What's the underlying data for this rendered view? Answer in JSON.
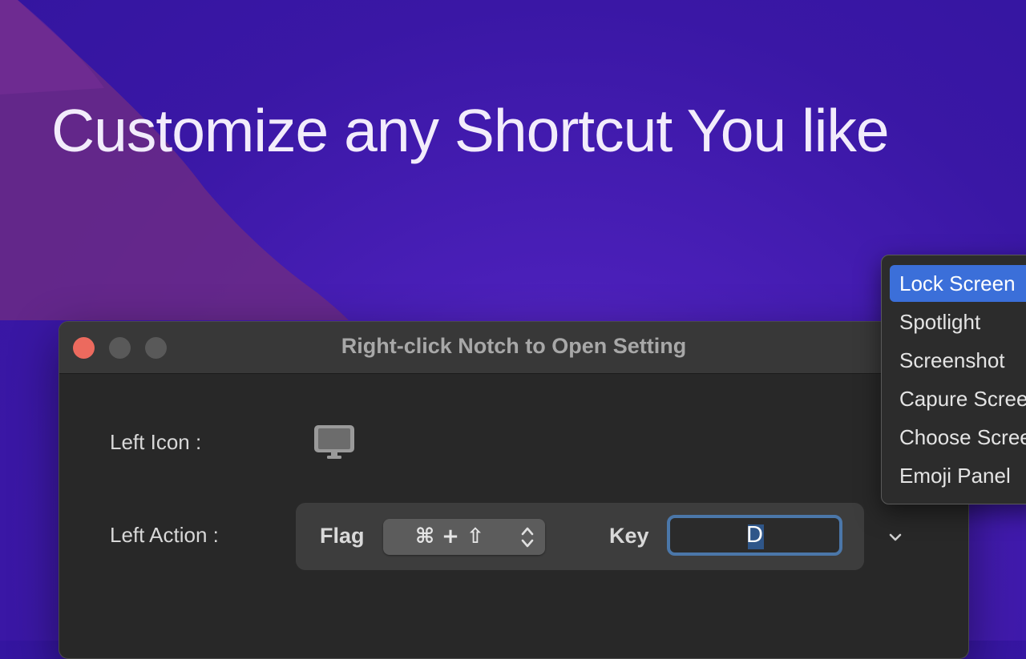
{
  "headline": "Customize any Shortcut You like",
  "window": {
    "title": "Right-click Notch to Open Setting",
    "controls": [
      "close",
      "minimize",
      "zoom"
    ]
  },
  "settings": {
    "left_icon_label": "Left Icon :",
    "left_icon": "monitor-icon",
    "left_action_label": "Left Action :",
    "flag_label": "Flag",
    "flag_value": "⌘ + ⇧",
    "key_label": "Key",
    "key_value": "D"
  },
  "menu": {
    "items": [
      {
        "label": "Lock Screen",
        "selected": true
      },
      {
        "label": "Spotlight",
        "selected": false
      },
      {
        "label": "Screenshot",
        "selected": false
      },
      {
        "label": "Capure Screen",
        "selected": false
      },
      {
        "label": "Choose Screen",
        "selected": false
      },
      {
        "label": "Emoji Panel",
        "selected": false
      }
    ]
  },
  "colors": {
    "background": "#3a17a5",
    "wave": "#6b2a86",
    "window_bg": "#282828",
    "titlebar_bg": "#383838",
    "close": "#ec6a5e",
    "focus_ring": "#4b77a9",
    "menu_selected": "#3b6fd9"
  }
}
